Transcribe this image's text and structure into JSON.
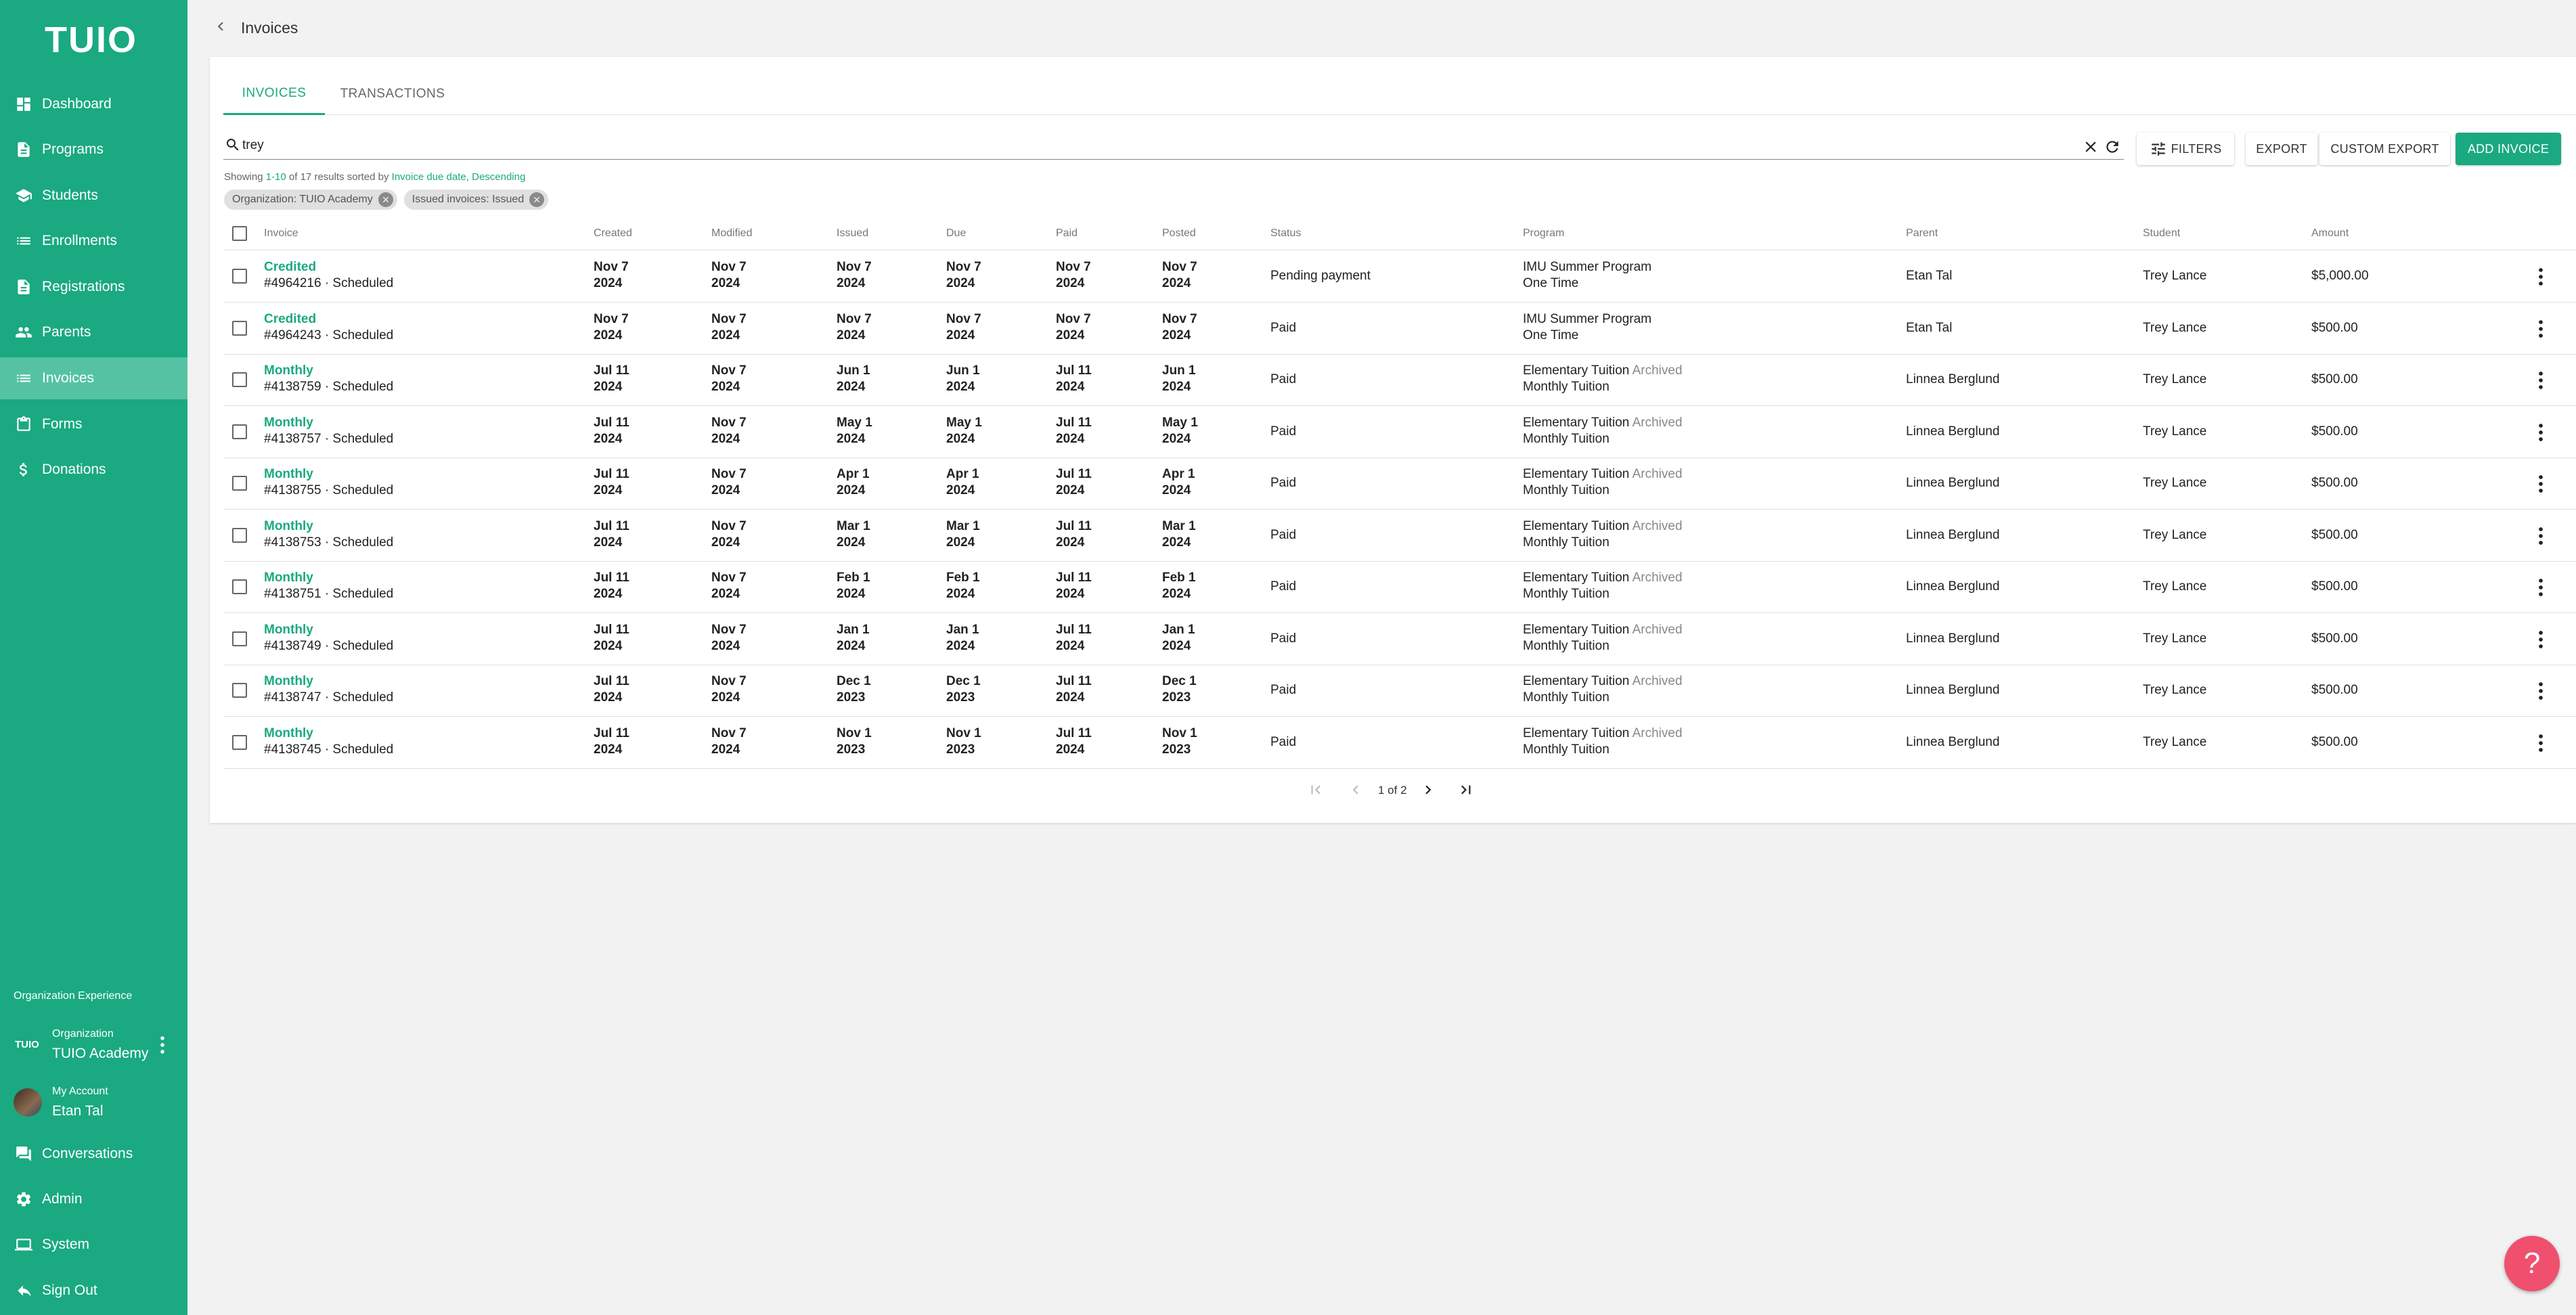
{
  "app": {
    "logo": "TUIO"
  },
  "sidebar": {
    "items": [
      {
        "label": "Dashboard",
        "icon": "dashboard-icon"
      },
      {
        "label": "Programs",
        "icon": "programs-icon"
      },
      {
        "label": "Students",
        "icon": "students-icon"
      },
      {
        "label": "Enrollments",
        "icon": "enrollments-icon"
      },
      {
        "label": "Registrations",
        "icon": "registrations-icon"
      },
      {
        "label": "Parents",
        "icon": "parents-icon"
      },
      {
        "label": "Invoices",
        "icon": "invoices-icon"
      },
      {
        "label": "Forms",
        "icon": "forms-icon"
      },
      {
        "label": "Donations",
        "icon": "donations-icon"
      }
    ],
    "active": "Invoices",
    "org_caption": "Organization Experience",
    "org": {
      "logo": "TUIO",
      "small": "Organization",
      "name": "TUIO Academy"
    },
    "account": {
      "small": "My Account",
      "name": "Etan Tal"
    },
    "bottom_items": [
      {
        "label": "Conversations",
        "icon": "conversations-icon"
      },
      {
        "label": "Admin",
        "icon": "admin-gear-icon"
      },
      {
        "label": "System",
        "icon": "system-icon"
      },
      {
        "label": "Sign Out",
        "icon": "sign-out-icon"
      }
    ]
  },
  "header": {
    "title": "Invoices"
  },
  "tabs": [
    {
      "label": "INVOICES"
    },
    {
      "label": "TRANSACTIONS"
    }
  ],
  "search": {
    "value": "trey"
  },
  "toolbar": {
    "filters": "FILTERS",
    "export": "EXPORT",
    "custom_export": "CUSTOM EXPORT",
    "add_invoice": "ADD INVOICE"
  },
  "showing": {
    "prefix": "Showing ",
    "range": "1-10",
    "mid": " of 17 results sorted by ",
    "sort_field": "Invoice due date",
    "sep": ", ",
    "sort_order": "Descending"
  },
  "chips": [
    {
      "label": "Organization: TUIO Academy"
    },
    {
      "label": "Issued invoices: Issued"
    }
  ],
  "table": {
    "headers": {
      "invoice": "Invoice",
      "created": "Created",
      "modified": "Modified",
      "issued": "Issued",
      "due": "Due",
      "paid": "Paid",
      "posted": "Posted",
      "status": "Status",
      "program": "Program",
      "parent": "Parent",
      "student": "Student",
      "amount": "Amount"
    },
    "rows": [
      {
        "type": "Credited",
        "number": "#4964216 · Scheduled",
        "created": [
          "Nov 7",
          "2024"
        ],
        "modified": [
          "Nov 7",
          "2024"
        ],
        "issued": [
          "Nov 7",
          "2024"
        ],
        "due": [
          "Nov 7",
          "2024"
        ],
        "paid": [
          "Nov 7",
          "2024"
        ],
        "posted": [
          "Nov 7",
          "2024"
        ],
        "status": "Pending payment",
        "program": "IMU Summer Program",
        "program_tag": "",
        "program_sub": "One Time",
        "parent": "Etan Tal",
        "student": "Trey Lance",
        "amount": "$5,000.00"
      },
      {
        "type": "Credited",
        "number": "#4964243 · Scheduled",
        "created": [
          "Nov 7",
          "2024"
        ],
        "modified": [
          "Nov 7",
          "2024"
        ],
        "issued": [
          "Nov 7",
          "2024"
        ],
        "due": [
          "Nov 7",
          "2024"
        ],
        "paid": [
          "Nov 7",
          "2024"
        ],
        "posted": [
          "Nov 7",
          "2024"
        ],
        "status": "Paid",
        "program": "IMU Summer Program",
        "program_tag": "",
        "program_sub": "One Time",
        "parent": "Etan Tal",
        "student": "Trey Lance",
        "amount": "$500.00"
      },
      {
        "type": "Monthly",
        "number": "#4138759 · Scheduled",
        "created": [
          "Jul 11",
          "2024"
        ],
        "modified": [
          "Nov 7",
          "2024"
        ],
        "issued": [
          "Jun 1",
          "2024"
        ],
        "due": [
          "Jun 1",
          "2024"
        ],
        "paid": [
          "Jul 11",
          "2024"
        ],
        "posted": [
          "Jun 1",
          "2024"
        ],
        "status": "Paid",
        "program": "Elementary Tuition",
        "program_tag": "Archived",
        "program_sub": "Monthly Tuition",
        "parent": "Linnea Berglund",
        "student": "Trey Lance",
        "amount": "$500.00"
      },
      {
        "type": "Monthly",
        "number": "#4138757 · Scheduled",
        "created": [
          "Jul 11",
          "2024"
        ],
        "modified": [
          "Nov 7",
          "2024"
        ],
        "issued": [
          "May 1",
          "2024"
        ],
        "due": [
          "May 1",
          "2024"
        ],
        "paid": [
          "Jul 11",
          "2024"
        ],
        "posted": [
          "May 1",
          "2024"
        ],
        "status": "Paid",
        "program": "Elementary Tuition",
        "program_tag": "Archived",
        "program_sub": "Monthly Tuition",
        "parent": "Linnea Berglund",
        "student": "Trey Lance",
        "amount": "$500.00"
      },
      {
        "type": "Monthly",
        "number": "#4138755 · Scheduled",
        "created": [
          "Jul 11",
          "2024"
        ],
        "modified": [
          "Nov 7",
          "2024"
        ],
        "issued": [
          "Apr 1",
          "2024"
        ],
        "due": [
          "Apr 1",
          "2024"
        ],
        "paid": [
          "Jul 11",
          "2024"
        ],
        "posted": [
          "Apr 1",
          "2024"
        ],
        "status": "Paid",
        "program": "Elementary Tuition",
        "program_tag": "Archived",
        "program_sub": "Monthly Tuition",
        "parent": "Linnea Berglund",
        "student": "Trey Lance",
        "amount": "$500.00"
      },
      {
        "type": "Monthly",
        "number": "#4138753 · Scheduled",
        "created": [
          "Jul 11",
          "2024"
        ],
        "modified": [
          "Nov 7",
          "2024"
        ],
        "issued": [
          "Mar 1",
          "2024"
        ],
        "due": [
          "Mar 1",
          "2024"
        ],
        "paid": [
          "Jul 11",
          "2024"
        ],
        "posted": [
          "Mar 1",
          "2024"
        ],
        "status": "Paid",
        "program": "Elementary Tuition",
        "program_tag": "Archived",
        "program_sub": "Monthly Tuition",
        "parent": "Linnea Berglund",
        "student": "Trey Lance",
        "amount": "$500.00"
      },
      {
        "type": "Monthly",
        "number": "#4138751 · Scheduled",
        "created": [
          "Jul 11",
          "2024"
        ],
        "modified": [
          "Nov 7",
          "2024"
        ],
        "issued": [
          "Feb 1",
          "2024"
        ],
        "due": [
          "Feb 1",
          "2024"
        ],
        "paid": [
          "Jul 11",
          "2024"
        ],
        "posted": [
          "Feb 1",
          "2024"
        ],
        "status": "Paid",
        "program": "Elementary Tuition",
        "program_tag": "Archived",
        "program_sub": "Monthly Tuition",
        "parent": "Linnea Berglund",
        "student": "Trey Lance",
        "amount": "$500.00"
      },
      {
        "type": "Monthly",
        "number": "#4138749 · Scheduled",
        "created": [
          "Jul 11",
          "2024"
        ],
        "modified": [
          "Nov 7",
          "2024"
        ],
        "issued": [
          "Jan 1",
          "2024"
        ],
        "due": [
          "Jan 1",
          "2024"
        ],
        "paid": [
          "Jul 11",
          "2024"
        ],
        "posted": [
          "Jan 1",
          "2024"
        ],
        "status": "Paid",
        "program": "Elementary Tuition",
        "program_tag": "Archived",
        "program_sub": "Monthly Tuition",
        "parent": "Linnea Berglund",
        "student": "Trey Lance",
        "amount": "$500.00"
      },
      {
        "type": "Monthly",
        "number": "#4138747 · Scheduled",
        "created": [
          "Jul 11",
          "2024"
        ],
        "modified": [
          "Nov 7",
          "2024"
        ],
        "issued": [
          "Dec 1",
          "2023"
        ],
        "due": [
          "Dec 1",
          "2023"
        ],
        "paid": [
          "Jul 11",
          "2024"
        ],
        "posted": [
          "Dec 1",
          "2023"
        ],
        "status": "Paid",
        "program": "Elementary Tuition",
        "program_tag": "Archived",
        "program_sub": "Monthly Tuition",
        "parent": "Linnea Berglund",
        "student": "Trey Lance",
        "amount": "$500.00"
      },
      {
        "type": "Monthly",
        "number": "#4138745 · Scheduled",
        "created": [
          "Jul 11",
          "2024"
        ],
        "modified": [
          "Nov 7",
          "2024"
        ],
        "issued": [
          "Nov 1",
          "2023"
        ],
        "due": [
          "Nov 1",
          "2023"
        ],
        "paid": [
          "Jul 11",
          "2024"
        ],
        "posted": [
          "Nov 1",
          "2023"
        ],
        "status": "Paid",
        "program": "Elementary Tuition",
        "program_tag": "Archived",
        "program_sub": "Monthly Tuition",
        "parent": "Linnea Berglund",
        "student": "Trey Lance",
        "amount": "$500.00"
      }
    ]
  },
  "pagination": {
    "text": "1 of 2"
  },
  "help": {
    "label": "?"
  },
  "colors": {
    "brand": "#1aa981",
    "brand_active": "#55c3a3",
    "help": "#f0506e"
  }
}
